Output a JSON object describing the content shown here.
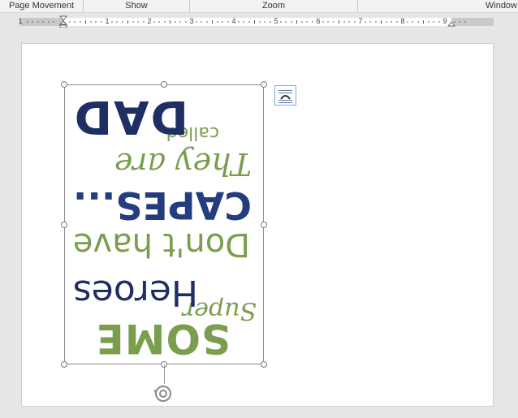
{
  "ribbon": {
    "groups": [
      "Page Movement",
      "Show",
      "Zoom",
      "Window"
    ]
  },
  "ruler": {
    "numbers": [
      "1",
      "1",
      "2",
      "3",
      "4",
      "5",
      "6",
      "7",
      "8",
      "9"
    ]
  },
  "image": {
    "words": {
      "some": "SOME",
      "super": "Super",
      "heroes": "Heroes",
      "dont": "Don't have",
      "capes": "CAPES...",
      "they": "They are",
      "called": "called",
      "dad": "DAD"
    },
    "colors": {
      "green": "#7a9e4e",
      "navy": "#1f2f63"
    }
  },
  "icons": {
    "layout_options": "layout-options-icon",
    "rotate": "rotate-handle-icon"
  }
}
